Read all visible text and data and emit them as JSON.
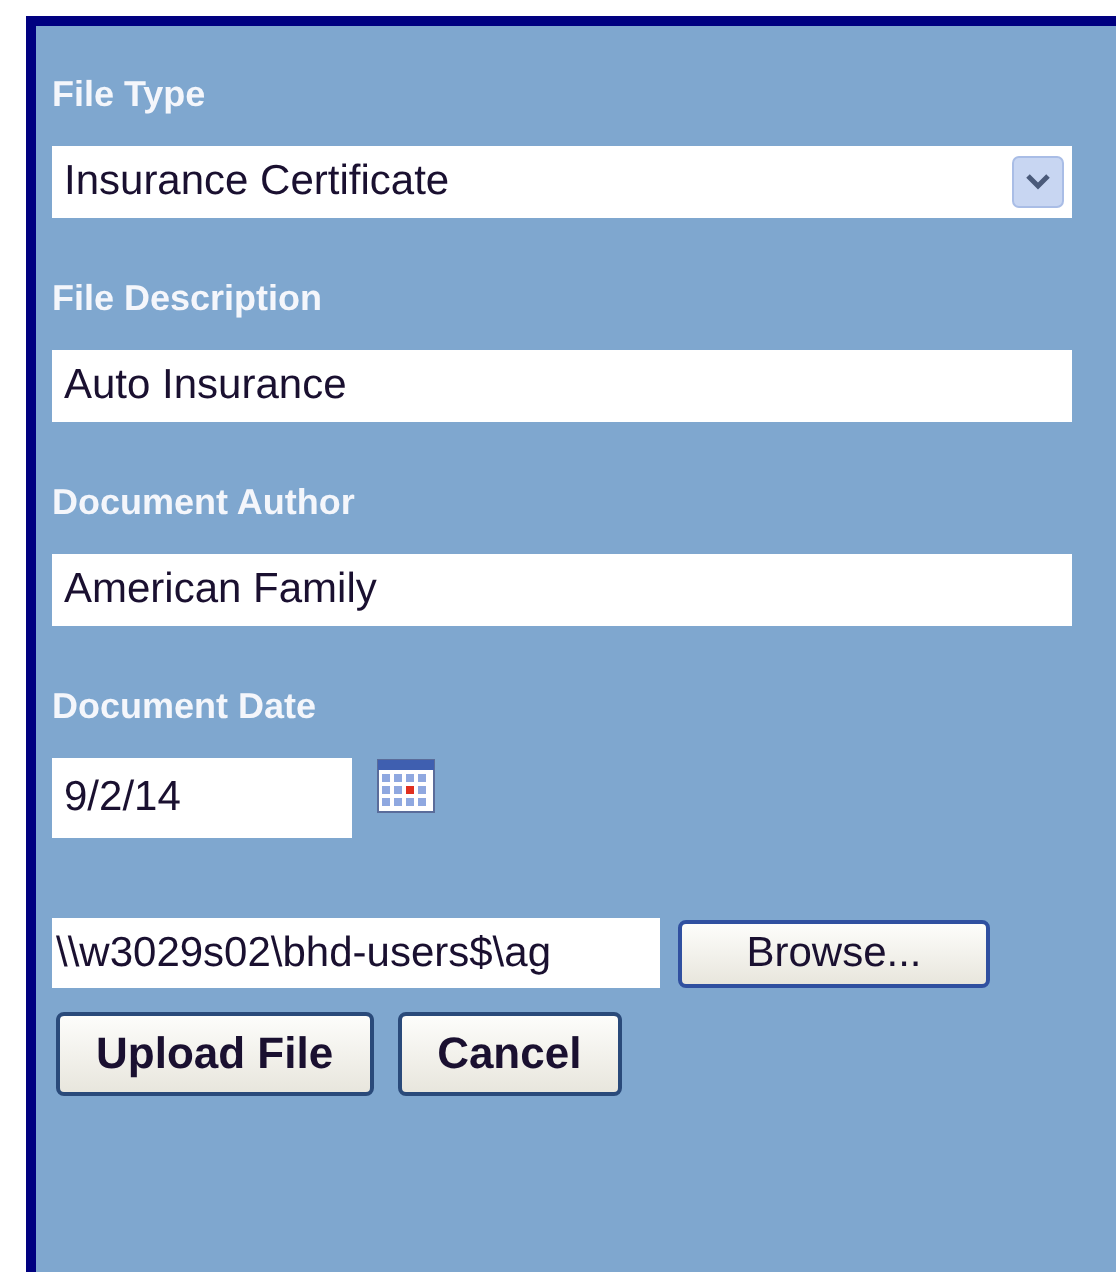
{
  "fields": [
    {
      "kind": "select",
      "label": "File Type",
      "value": "Insurance Certificate"
    },
    {
      "kind": "text",
      "label": "File Description",
      "value": "Auto Insurance"
    },
    {
      "kind": "text",
      "label": "Document Author",
      "value": "American Family"
    },
    {
      "kind": "date",
      "label": "Document Date",
      "value": "9/2/14"
    }
  ],
  "file": {
    "path": "\\\\w3029s02\\bhd-users$\\ag",
    "browse": "Browse..."
  },
  "buttons": [
    "Upload File",
    "Cancel"
  ]
}
